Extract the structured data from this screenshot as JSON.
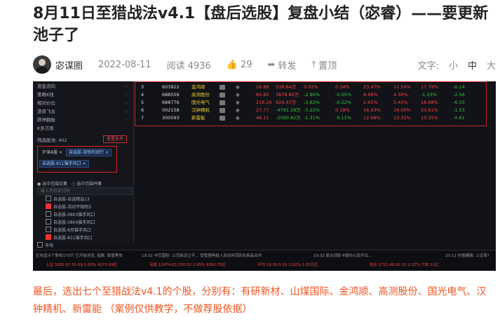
{
  "article": {
    "title": "8月11日至猎战法v4.1【盘后选股】复盘小结（宓睿）——要更新池子了",
    "author": "宓谋圈",
    "date": "2022-08-11",
    "views_label": "阅读 4936",
    "likes": "29",
    "forward_label": "转发",
    "top_label": "置顶",
    "fontsize_label": "文字:",
    "fontsize_small": "小",
    "fontsize_medium": "中",
    "fontsize_large": "大",
    "caption": "最后，选出七个至猎战法v4.1的个股，分别有：有研新材、山煤国际、金鸿顺、高测股份、国光电气、汉钟精机、新雷能 （案例仅供教学，不做荐股依据）"
  },
  "screenshot": {
    "menu": [
      "资金流向",
      "策略K线",
      "相对价位",
      "游资飞关",
      "跌停翻板",
      "K多方阵"
    ],
    "filter_label": "筛选股池: 402",
    "filter_button": "重置条件",
    "tags": [
      "沪深A股 ×",
      "自选股-游侠利润行 ×",
      "自选股-811猫手风口 ×"
    ],
    "radio_a": "选中范围交集",
    "radio_b": "选中范围并集",
    "search_placeholder": "输入名称或代码",
    "checks": [
      {
        "label": "自选股-自选精选13",
        "on": false
      },
      {
        "label": "自选股-活动不限制3",
        "on": true
      },
      {
        "label": "自选股-0803猫手风口",
        "on": false
      },
      {
        "label": "自选股-0804猫手风口",
        "on": false
      },
      {
        "label": "自选股-8月猫手风口",
        "on": false
      },
      {
        "label": "自选股-811猫手风口",
        "on": true
      },
      {
        "label": "市场",
        "on": false
      }
    ],
    "rows": [
      {
        "idx": "3",
        "code": "603922",
        "name": "金鸿顺",
        "c1": "26.88",
        "c2": "539.64万",
        "c3": "0.52%",
        "c4": "0.34%",
        "c5": "23.47%",
        "c6": "11.54%",
        "c7": "17.79%",
        "c8": "-0.14"
      },
      {
        "idx": "4",
        "code": "688556",
        "name": "高测股份",
        "c1": "85.85",
        "c2": "3878.80万",
        "c3": "-2.90%",
        "c4": "-0.05%",
        "c5": "8.99%",
        "c6": "4.30%",
        "c7": "-1.33%",
        "c8": "-2.56"
      },
      {
        "idx": "5",
        "code": "688776",
        "name": "国光电气",
        "c1": "218.26",
        "c2": "929.47万",
        "c3": "-2.82%",
        "c4": "-0.22%",
        "c5": "2.65%",
        "c6": "5.43%",
        "c7": "18.68%",
        "c8": "-6.33"
      },
      {
        "idx": "6",
        "code": "002158",
        "name": "汉钟精机",
        "c1": "27.77",
        "c2": "-4791.28万",
        "c3": "-5.22%",
        "c4": "0.18%",
        "c5": "16.63%",
        "c6": "16.00%",
        "c7": "23.81%",
        "c8": "-1.53"
      },
      {
        "idx": "7",
        "code": "300593",
        "name": "新雷能",
        "c1": "46.11",
        "c2": "-2590.82万",
        "c3": "-1.31%",
        "c4": "-0.11%",
        "c5": "12.68%",
        "c6": "13.32%",
        "c7": "13.35%",
        "c8": "-0.61"
      }
    ],
    "status": {
      "s1": "区块显示个股校170只 已开始浏览, 指数, 算值等效",
      "s2": "19:32 中芯国际: 公司拟设立平... 受管理再投入双社网活跃化新品出市",
      "s3": "19:32 复合消影卡股份以及开业...",
      "s4": "20:12 外围编辑: 上证率?",
      "i1": "上证 3281.67 51.69 1.60% 4273.99亿",
      "i2": "深成 12474.03 250.52 2.05% 6392.75亿",
      "i3": "平均 19.30 0.19 1.02% 1.05万亿",
      "i4": "创业 2721.46 62.91 2.37% 738.11亿"
    }
  }
}
